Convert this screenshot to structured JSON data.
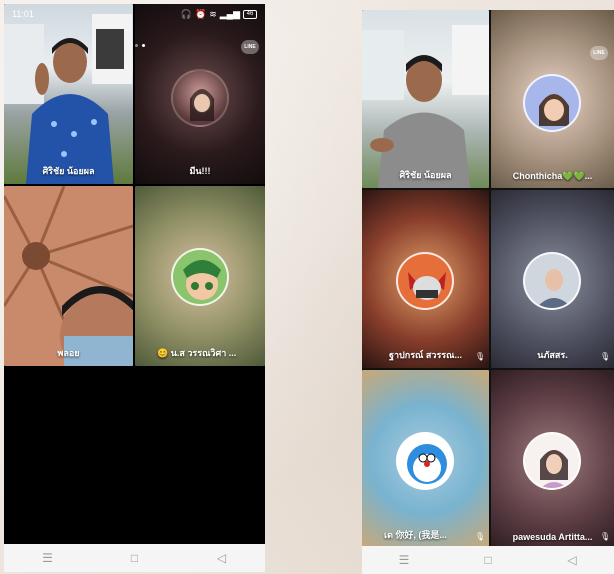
{
  "left_screen": {
    "status_bar": {
      "time": "11:01",
      "battery": "46"
    },
    "participants": [
      {
        "name": "ศิริชัย น้อยผล",
        "kind": "video"
      },
      {
        "name": "มีน!!!",
        "kind": "avatar"
      },
      {
        "name": "พลอย",
        "kind": "video"
      },
      {
        "name": "😊 น.ส วรรณวิศา ...",
        "kind": "avatar"
      }
    ],
    "line_logo": "LINE"
  },
  "right_screen": {
    "participants": [
      {
        "name": "ศิริชัย น้อยผล",
        "kind": "video"
      },
      {
        "name": "Chonthicha💚💚...",
        "kind": "avatar"
      },
      {
        "name": "ฐาปกรณ์ สวรรณ...",
        "kind": "avatar",
        "mic": "mic-off-icon"
      },
      {
        "name": "นภัสสร.",
        "kind": "avatar",
        "mic": "mic-off-icon"
      },
      {
        "name": "เด 你好, (我是...",
        "kind": "avatar",
        "mic": "mic-off-icon"
      },
      {
        "name": "pawesuda Artitta...",
        "kind": "avatar",
        "mic": "mic-off-icon"
      }
    ],
    "line_logo": "LINE"
  },
  "nav": {
    "menu": "☰",
    "home": "□",
    "back": "◁"
  },
  "colors": {
    "bg": "#efe8e1",
    "nav": "#f5f5f5",
    "tile_dark": "#1a1a1a"
  }
}
